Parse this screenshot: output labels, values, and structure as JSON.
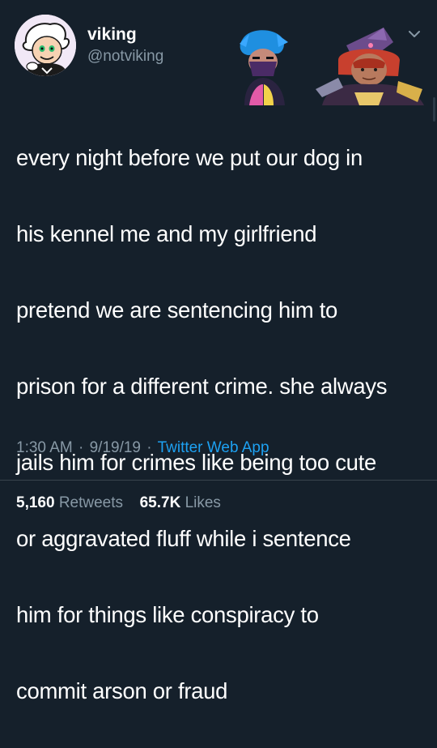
{
  "author": {
    "display_name": "viking",
    "handle": "@notviking",
    "avatar_icon": "cartoon-avatar-icon"
  },
  "tweet": {
    "lines": [
      "every night before we put our dog in",
      "his kennel me and my girlfriend",
      "pretend we are sentencing him to",
      "prison for a different crime. she always",
      "jails him for crimes like being too cute",
      "or aggravated fluff while i sentence",
      "him for things like conspiracy to",
      "commit arson or fraud"
    ]
  },
  "meta": {
    "time": "1:30 AM",
    "date": "9/19/19",
    "source": "Twitter Web App",
    "separator": "·"
  },
  "stats": {
    "retweets_count": "5,160",
    "retweets_label": "Retweets",
    "likes_count": "65.7K",
    "likes_label": "Likes"
  },
  "colors": {
    "background": "#15202b",
    "text": "#ffffff",
    "secondary": "#8899a6",
    "link": "#1da1f2",
    "divider": "#38444d"
  }
}
